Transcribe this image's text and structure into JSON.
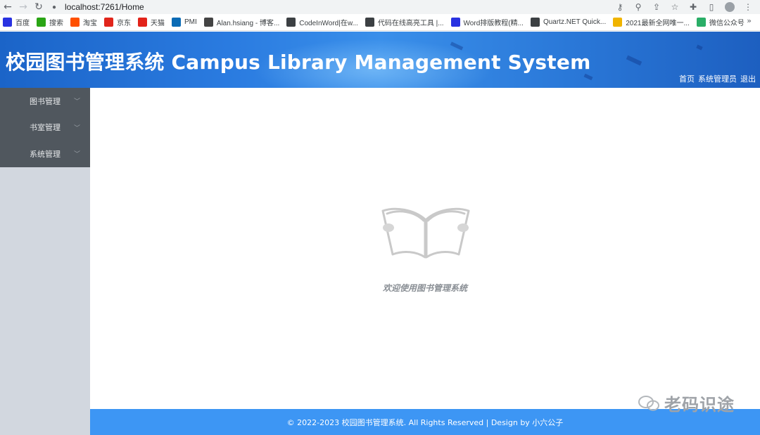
{
  "browser": {
    "url": "localhost:7261/Home",
    "bookmarks": [
      {
        "label": "百度",
        "color": "#2932e1",
        "icon": "baidu-icon"
      },
      {
        "label": "搜索",
        "color": "#2aa515",
        "icon": "search-engine-icon"
      },
      {
        "label": "淘宝",
        "color": "#ff5000",
        "icon": "taobao-icon"
      },
      {
        "label": "京东",
        "color": "#e1251b",
        "icon": "jd-icon"
      },
      {
        "label": "天猫",
        "color": "#e2231a",
        "icon": "tmall-icon"
      },
      {
        "label": "PMI",
        "color": "#0a6bb5",
        "icon": "pmi-icon"
      },
      {
        "label": "Alan.hsiang - 博客...",
        "color": "#444444",
        "icon": "blog-icon"
      },
      {
        "label": "CodeInWord|在w...",
        "color": "#3c4043",
        "icon": "globe-icon"
      },
      {
        "label": "代码在线高亮工具 |...",
        "color": "#3c4043",
        "icon": "globe-icon"
      },
      {
        "label": "Word排版教程(精...",
        "color": "#2932e1",
        "icon": "baidu-icon"
      },
      {
        "label": "Quartz.NET Quick...",
        "color": "#3c4043",
        "icon": "quartz-icon"
      },
      {
        "label": "2021最新全网唯一...",
        "color": "#f0b400",
        "icon": "cube-icon"
      },
      {
        "label": "微信公众号",
        "color": "#2aae67",
        "icon": "wechat-icon"
      }
    ],
    "more": "»"
  },
  "header": {
    "title": "校园图书管理系统 Campus Library Management System",
    "links": [
      "首页",
      "系统管理员",
      "退出"
    ]
  },
  "sidebar": {
    "items": [
      {
        "label": "图书管理"
      },
      {
        "label": "书室管理"
      },
      {
        "label": "系统管理"
      }
    ]
  },
  "main": {
    "welcome": "欢迎使用图书管理系统"
  },
  "footer": {
    "text": "© 2022-2023 校园图书管理系统. All Rights Reserved | Design by 小六公子"
  },
  "watermark": {
    "text": "老码识途"
  }
}
